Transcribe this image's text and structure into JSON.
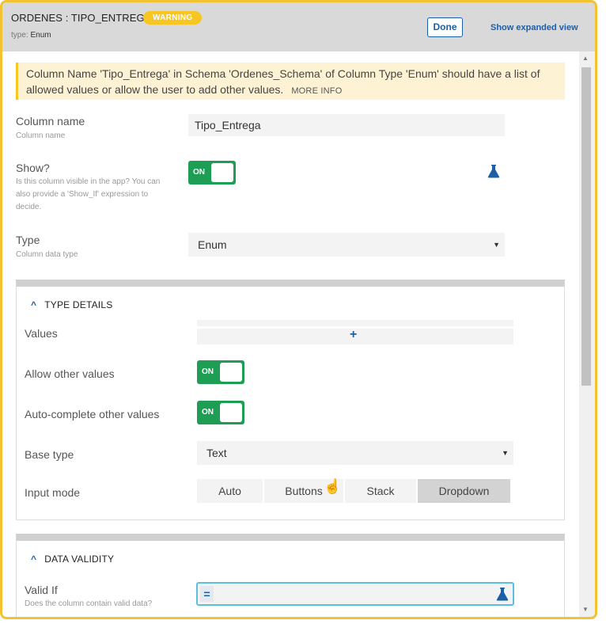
{
  "header": {
    "title": "ORDENES : TIPO_ENTREGA",
    "badge": "WARNING",
    "type_prefix": "type:",
    "type_value": "Enum",
    "done_label": "Done",
    "expanded_label": "Show expanded view"
  },
  "warning": {
    "text": "Column Name 'Tipo_Entrega' in Schema 'Ordenes_Schema' of Column Type 'Enum' should have a list of allowed values or allow the user to add other values.",
    "more_info": "MORE INFO"
  },
  "column_name": {
    "label": "Column name",
    "help": "Column name",
    "value": "Tipo_Entrega"
  },
  "show": {
    "label": "Show?",
    "help": "Is this column visible in the app? You can also provide a 'Show_If' expression to decide.",
    "toggle": "ON"
  },
  "type": {
    "label": "Type",
    "help": "Column data type",
    "value": "Enum"
  },
  "type_details": {
    "heading": "TYPE DETAILS",
    "values_label": "Values",
    "add_symbol": "+",
    "allow_other_label": "Allow other values",
    "allow_other_toggle": "ON",
    "autocomplete_label": "Auto-complete other values",
    "autocomplete_toggle": "ON",
    "base_type_label": "Base type",
    "base_type_value": "Text",
    "input_mode_label": "Input mode",
    "input_modes": [
      "Auto",
      "Buttons",
      "Stack",
      "Dropdown"
    ],
    "input_mode_selected": "Dropdown"
  },
  "data_validity": {
    "heading": "DATA VALIDITY",
    "valid_if_label": "Valid If",
    "valid_if_help": "Does the column contain valid data?",
    "eq_symbol": "="
  },
  "colors": {
    "accent": "#1a5fa8",
    "toggle_on": "#1e9e55",
    "warning": "#f7c623",
    "border": "#f2c230"
  },
  "icons": [
    "beaker-icon",
    "chevron-up-icon",
    "caret-down-icon",
    "hand-cursor-icon"
  ]
}
